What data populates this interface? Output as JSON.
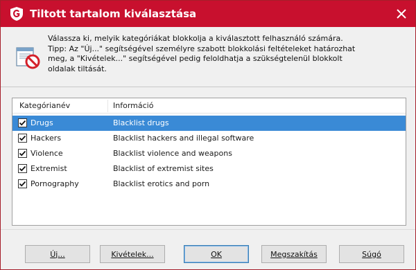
{
  "window": {
    "title": "Tiltott tartalom kiválasztása",
    "accent_color": "#c8102e"
  },
  "info": {
    "icon": "blocked-document-icon",
    "text": "Válassza ki, melyik kategóriákat blokkolja a kiválasztott felhasználó számára.\nTipp: Az \"Új...\" segítségével személyre szabott blokkolási feltételeket határozhat\nmeg, a \"Kivételek...\" segítségével pedig feloldhatja a szükségtelenül blokkolt\noldalak tiltását."
  },
  "list": {
    "columns": [
      "Kategórianév",
      "Információ"
    ],
    "rows": [
      {
        "name": "Drugs",
        "info": "Blacklist drugs",
        "checked": true,
        "selected": true
      },
      {
        "name": "Hackers",
        "info": "Blacklist hackers and illegal software",
        "checked": true,
        "selected": false
      },
      {
        "name": "Violence",
        "info": "Blacklist violence and weapons",
        "checked": true,
        "selected": false
      },
      {
        "name": "Extremist",
        "info": "Blacklist of extremist sites",
        "checked": true,
        "selected": false
      },
      {
        "name": "Pornography",
        "info": "Blacklist erotics and porn",
        "checked": true,
        "selected": false
      }
    ],
    "selection_color": "#3a8ad6"
  },
  "buttons": {
    "new": "Új...",
    "exceptions": "Kivételek...",
    "ok": "OK",
    "cancel": "Megszakítás",
    "help": "Súgó"
  }
}
